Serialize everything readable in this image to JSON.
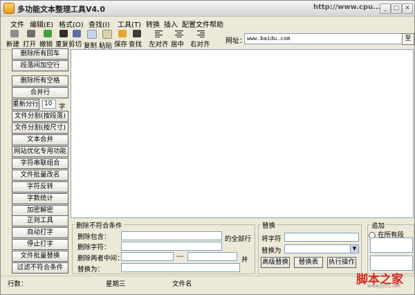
{
  "window": {
    "title": "多功能文本整理工具V4.0",
    "title_url": "http://www.cpu...",
    "min": "_",
    "max": "□",
    "close": "✕"
  },
  "menu": [
    "文件",
    "编辑(E)",
    "格式(O)",
    "查找(I)",
    "工具(T)",
    "转换",
    "插入",
    "配置文件",
    "帮助"
  ],
  "toolbar": {
    "buttons": [
      "新建",
      "打开",
      "撤销",
      "重复",
      "剪切",
      "复制",
      "粘贴",
      "保存",
      "查找"
    ],
    "align": [
      "左对齐",
      "居中",
      "右对齐"
    ],
    "url_label": "网址：",
    "url_value": "www.baidu.com",
    "go": "至"
  },
  "sidebar": {
    "buttons": [
      "删除所有回车",
      "段落间加空行",
      "删除所有空格",
      "合并行",
      "重新分行",
      "文件分割(按段落)",
      "文件分割(按尺寸)",
      "文本合并",
      "网站优化专用功能",
      "字符串联组合",
      "文件批量改名",
      "字符反转",
      "字数统计",
      "加密解密",
      "正则工具",
      "自动打字",
      "停止打字",
      "文件批量替换",
      "过滤不符合条件"
    ],
    "split_value": "10",
    "split_unit": "字"
  },
  "filter": {
    "title": "删除不符合条件",
    "include_label": "删除包含：",
    "include_suffix": "的全部行",
    "char_label": "删除字符：",
    "between_label": "删除两者中间：",
    "between_dash": "---",
    "between_and": "并",
    "replace_label": "替换为："
  },
  "replace": {
    "title": "替换",
    "from_label": "将字符",
    "to_label": "替换为",
    "advanced": "高级替换",
    "table": "替换表",
    "execute": "执行操作"
  },
  "append": {
    "title": "追加",
    "option_all": "在所有段"
  },
  "status": {
    "lines": "行数：",
    "weekday": "星期三",
    "file": "文件名"
  },
  "watermark": {
    "text": "脚本之家",
    "url": "www.jb51.net"
  }
}
